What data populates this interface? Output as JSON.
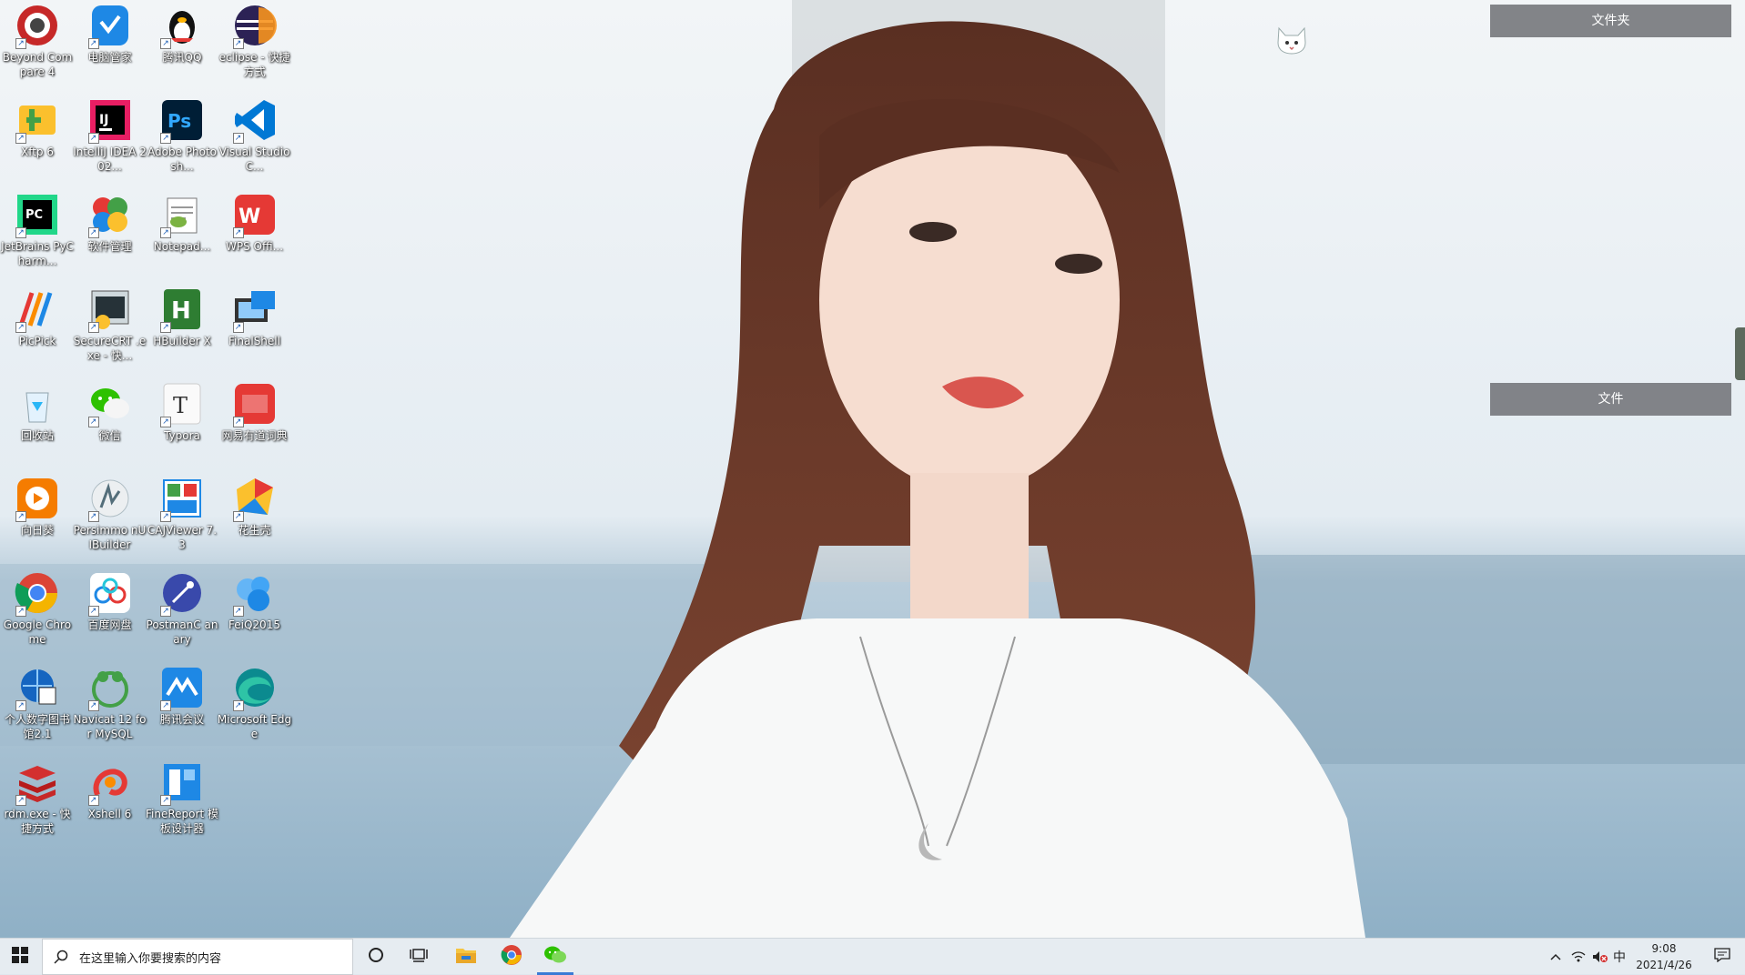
{
  "desktop": {
    "icons": [
      {
        "label": "Beyond Compare 4",
        "icon": "beyond-compare-icon"
      },
      {
        "label": "电脑管家",
        "icon": "tencent-pc-manager-icon"
      },
      {
        "label": "腾讯QQ",
        "icon": "qq-penguin-icon"
      },
      {
        "label": "eclipse - 快捷方式",
        "icon": "eclipse-icon"
      },
      {
        "label": "Xftp 6",
        "icon": "xftp-icon"
      },
      {
        "label": "IntelliJ IDEA 202...",
        "icon": "intellij-idea-icon"
      },
      {
        "label": "Adobe Photosh...",
        "icon": "photoshop-icon"
      },
      {
        "label": "Visual Studio C...",
        "icon": "vscode-icon"
      },
      {
        "label": "JetBrains PyCharm...",
        "icon": "pycharm-icon"
      },
      {
        "label": "软件管理",
        "icon": "software-manager-icon"
      },
      {
        "label": "Notepad...",
        "icon": "notepad-plus-icon"
      },
      {
        "label": "WPS Offi...",
        "icon": "wps-office-icon"
      },
      {
        "label": "PicPick",
        "icon": "picpick-icon"
      },
      {
        "label": "SecureCRT .exe - 快...",
        "icon": "securecrt-icon"
      },
      {
        "label": "HBuilder X",
        "icon": "hbuilderx-icon"
      },
      {
        "label": "FinalShell",
        "icon": "finalshell-icon"
      },
      {
        "label": "回收站",
        "icon": "recycle-bin-icon"
      },
      {
        "label": "微信",
        "icon": "wechat-icon"
      },
      {
        "label": "Typora",
        "icon": "typora-icon"
      },
      {
        "label": "网易有道词典",
        "icon": "youdao-dict-icon"
      },
      {
        "label": "向日葵",
        "icon": "sunflower-remote-icon"
      },
      {
        "label": "Persimmo nUIBuilder",
        "icon": "persimmon-uibuilder-icon"
      },
      {
        "label": "CAJViewer 7.3",
        "icon": "cajviewer-icon"
      },
      {
        "label": "花生壳",
        "icon": "peanut-shell-icon"
      },
      {
        "label": "Google Chrome",
        "icon": "chrome-icon"
      },
      {
        "label": "百度网盘",
        "icon": "baidu-netdisk-icon"
      },
      {
        "label": "PostmanC anary",
        "icon": "postman-canary-icon"
      },
      {
        "label": "FeiQ2015",
        "icon": "feiq-icon"
      },
      {
        "label": "个人数字图书馆2.1",
        "icon": "digital-library-icon"
      },
      {
        "label": "Navicat 12 for MySQL",
        "icon": "navicat-icon"
      },
      {
        "label": "腾讯会议",
        "icon": "tencent-meeting-icon"
      },
      {
        "label": "Microsoft Edge",
        "icon": "edge-icon"
      },
      {
        "label": "rdm.exe - 快捷方式",
        "icon": "redis-desktop-icon"
      },
      {
        "label": "Xshell 6",
        "icon": "xshell-icon"
      },
      {
        "label": "FineReport 模板设计器",
        "icon": "finereport-icon"
      }
    ]
  },
  "panels": {
    "top_label": "文件夹",
    "bottom_label": "文件"
  },
  "taskbar": {
    "search_placeholder": "在这里输入你要搜索的内容",
    "ime_indicator": "中",
    "time": "9:08",
    "date": "2021/4/26"
  },
  "colors": {
    "taskbar_bg": "#e6ecf1",
    "panel_bg": "#6e7074",
    "active_underline": "#3a7bd5"
  }
}
